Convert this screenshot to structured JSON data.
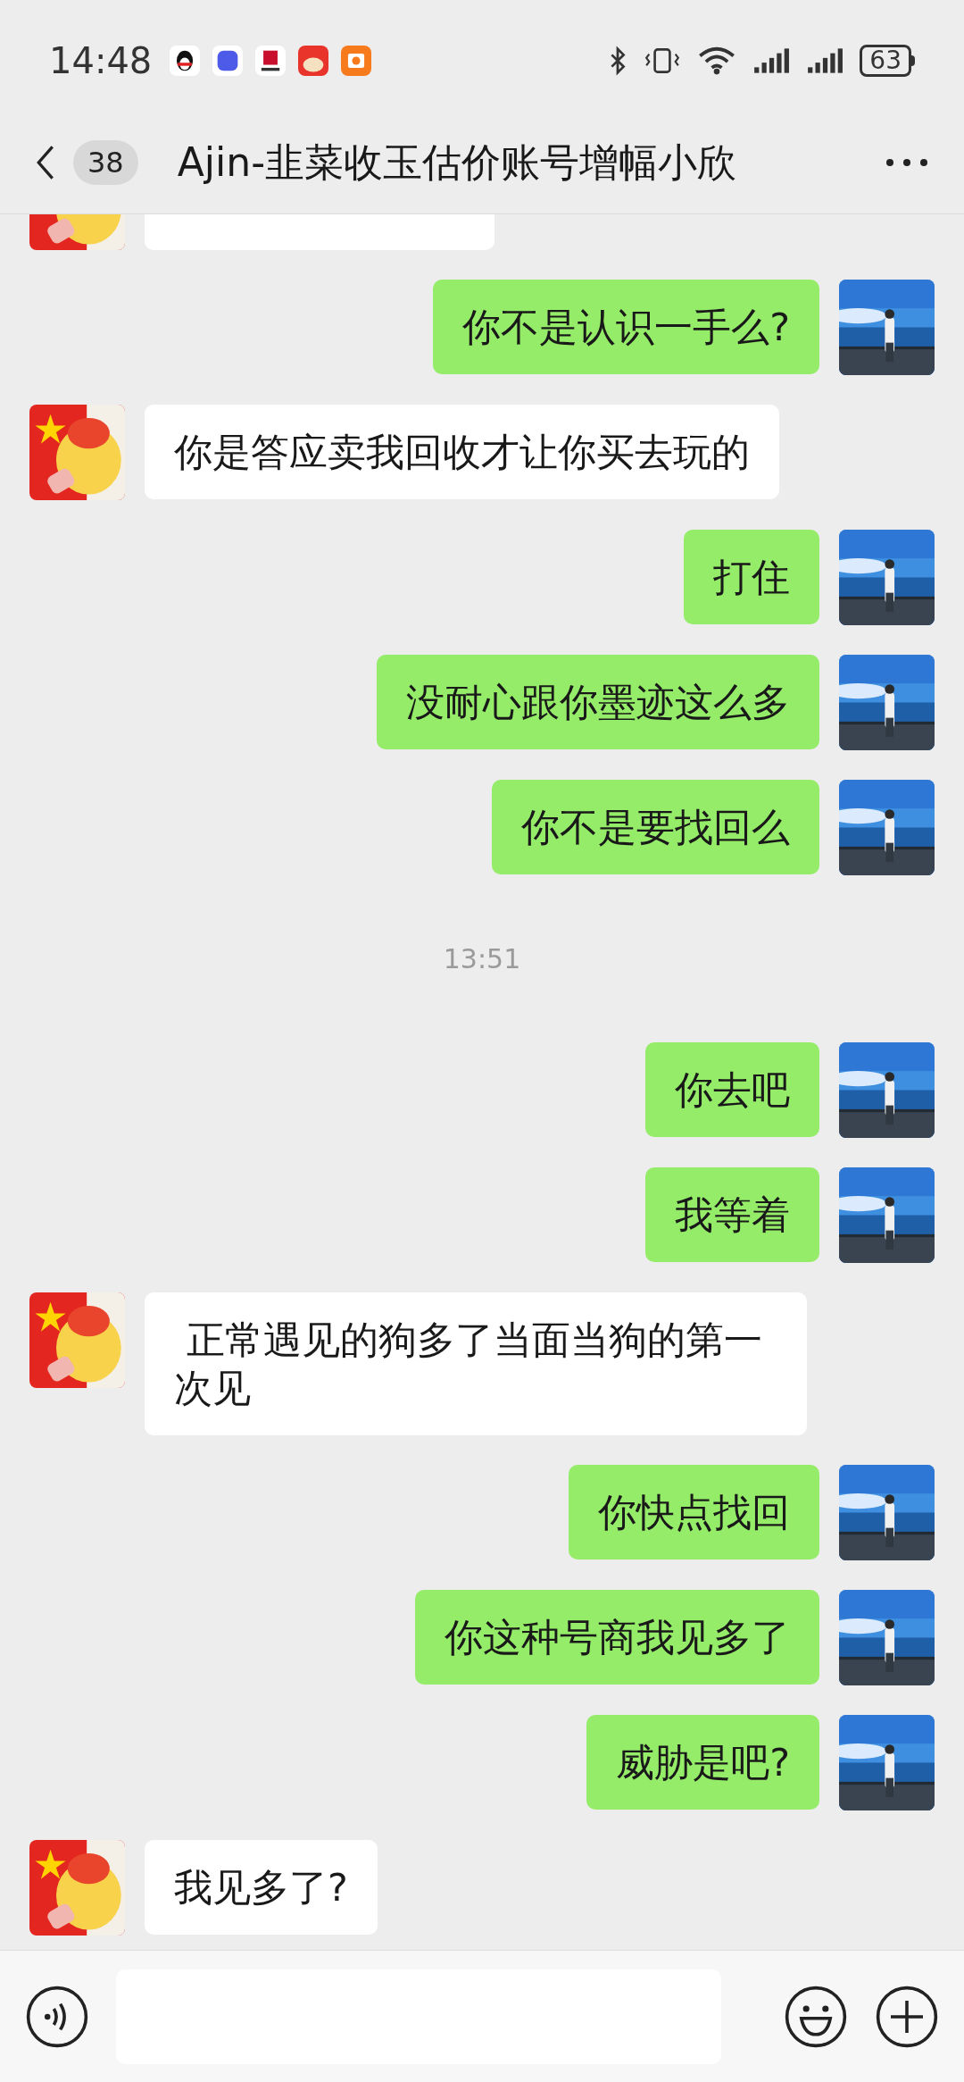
{
  "status_bar": {
    "time": "14:48",
    "battery": "63"
  },
  "header": {
    "unread_count": "38",
    "title": "Ajin-韭菜收玉估价账号增幅小欣"
  },
  "messages": [
    {
      "kind": "incoming_partial"
    },
    {
      "kind": "outgoing",
      "text": "你不是认识一手么?"
    },
    {
      "kind": "incoming",
      "text": "你是答应卖我回收才让你买去玩的"
    },
    {
      "kind": "outgoing",
      "text": "打住"
    },
    {
      "kind": "outgoing",
      "text": "没耐心跟你墨迹这么多"
    },
    {
      "kind": "outgoing",
      "text": "你不是要找回么"
    },
    {
      "kind": "time",
      "text": "13:51"
    },
    {
      "kind": "outgoing",
      "text": "你去吧"
    },
    {
      "kind": "outgoing",
      "text": "我等着"
    },
    {
      "kind": "incoming",
      "text": " 正常遇见的狗多了当面当狗的第一次见"
    },
    {
      "kind": "outgoing",
      "text": "你快点找回"
    },
    {
      "kind": "outgoing",
      "text": "你这种号商我见多了"
    },
    {
      "kind": "outgoing",
      "text": "威胁是吧?"
    },
    {
      "kind": "incoming",
      "text": "我见多了?"
    }
  ]
}
